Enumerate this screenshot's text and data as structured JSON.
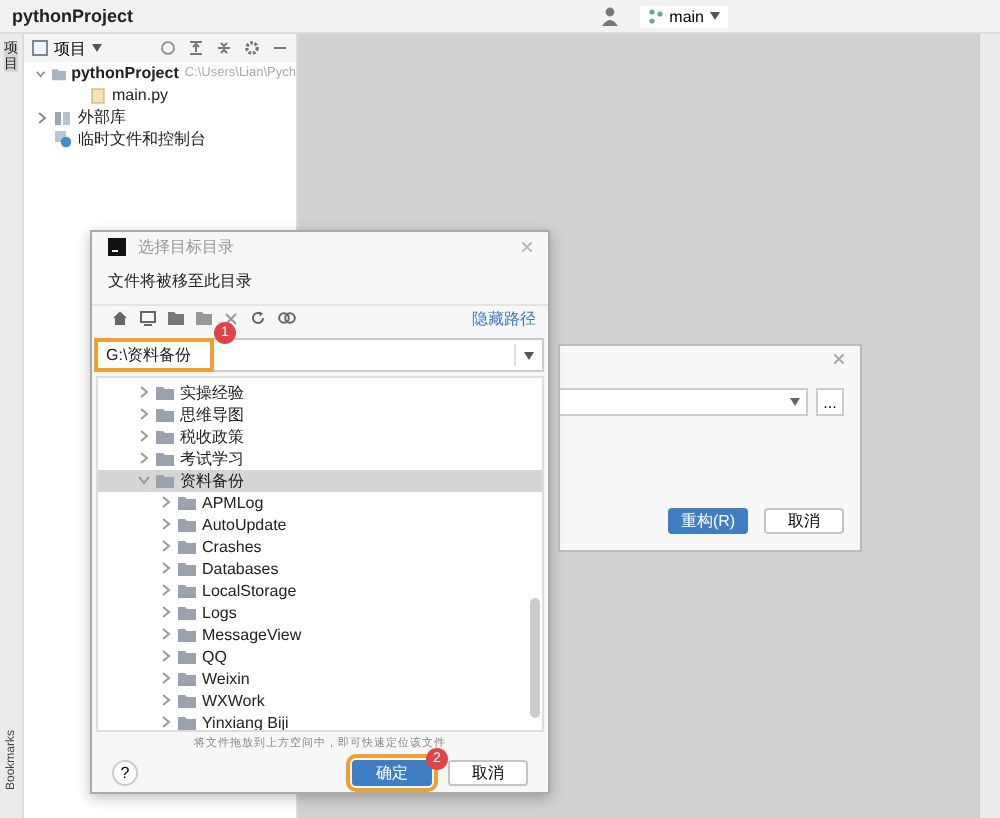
{
  "window": {
    "title": "pythonProject",
    "branch": "main"
  },
  "project_panel": {
    "tab": "项目",
    "title": "项目",
    "tree": [
      {
        "label": "pythonProject",
        "path": "C:\\Users\\Lian\\Pych",
        "kind": "folder",
        "expanded": true,
        "children": [
          {
            "label": "main.py",
            "kind": "file"
          }
        ]
      },
      {
        "label": "外部库",
        "kind": "library",
        "expanded": false
      },
      {
        "label": "临时文件和控制台",
        "kind": "scratch"
      }
    ]
  },
  "bookmarks_tab": "Bookmarks",
  "back_dialog": {
    "more_button": "...",
    "buttons": [
      {
        "label": "重构(R)",
        "primary": true
      },
      {
        "label": "取消",
        "primary": false
      }
    ]
  },
  "dialog": {
    "title": "选择目标目录",
    "subtitle": "文件将被移至此目录",
    "hide_path_link": "隐藏路径",
    "path": "G:\\资料备份",
    "path_highlighted": true,
    "path_badge": "1",
    "tree": [
      {
        "label": "实操经验",
        "expanded": false,
        "selected": false
      },
      {
        "label": "思维导图",
        "expanded": false,
        "selected": false
      },
      {
        "label": "税收政策",
        "expanded": false,
        "selected": false
      },
      {
        "label": "考试学习",
        "expanded": false,
        "selected": false
      },
      {
        "label": "资料备份",
        "expanded": true,
        "selected": true,
        "children": [
          {
            "label": "APMLog",
            "expanded": false,
            "selected": false
          },
          {
            "label": "AutoUpdate",
            "expanded": false,
            "selected": false
          },
          {
            "label": "Crashes",
            "expanded": false,
            "selected": false
          },
          {
            "label": "Databases",
            "expanded": false,
            "selected": false
          },
          {
            "label": "LocalStorage",
            "expanded": false,
            "selected": false
          },
          {
            "label": "Logs",
            "expanded": false,
            "selected": false
          },
          {
            "label": "MessageView",
            "expanded": false,
            "selected": false
          },
          {
            "label": "QQ",
            "expanded": false,
            "selected": false
          },
          {
            "label": "Weixin",
            "expanded": false,
            "selected": false
          },
          {
            "label": "WXWork",
            "expanded": false,
            "selected": false
          },
          {
            "label": "Yinxiang Biji",
            "expanded": false,
            "selected": false
          }
        ]
      }
    ],
    "hint": "将文件拖放到上方空间中，即可快速定位该文件",
    "help": "?",
    "buttons": [
      {
        "label": "确定",
        "primary": true,
        "highlighted": true,
        "badge": "2"
      },
      {
        "label": "取消",
        "primary": false,
        "highlighted": false
      }
    ]
  }
}
